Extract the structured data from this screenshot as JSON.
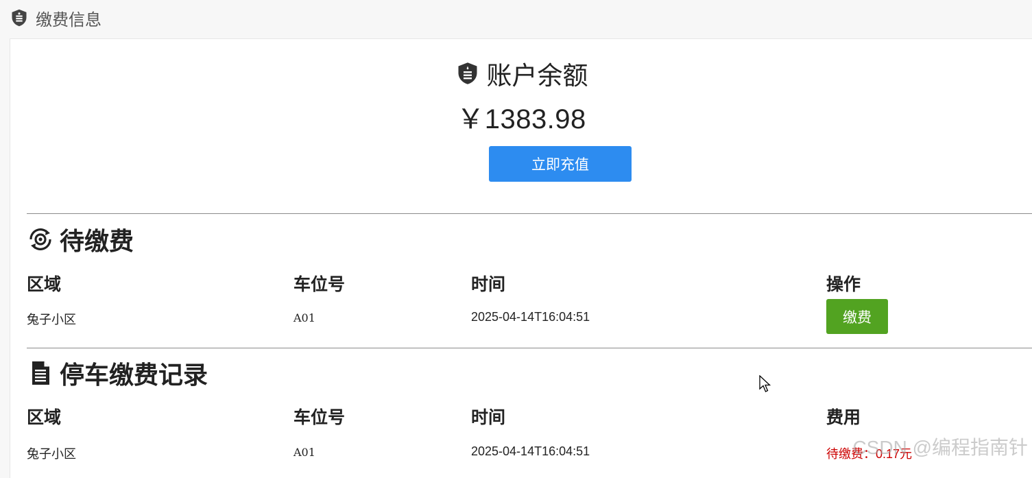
{
  "header": {
    "title": "缴费信息",
    "icon": "shield-icon"
  },
  "balance": {
    "title": "账户余额",
    "title_icon": "shield-icon",
    "amount": "￥1383.98",
    "recharge_label": "立即充值",
    "recharge_color": "#2d8cf0"
  },
  "pending": {
    "title": "待缴费",
    "icon": "refresh-eye-icon",
    "columns": [
      "区域",
      "车位号",
      "时间",
      "操作"
    ],
    "rows": [
      {
        "area": "兔子小区",
        "space": "A01",
        "time": "2025-04-14T16:04:51",
        "action_label": "缴费"
      }
    ],
    "action_color": "#52a321"
  },
  "records": {
    "title": "停车缴费记录",
    "icon": "document-icon",
    "columns": [
      "区域",
      "车位号",
      "时间",
      "费用"
    ],
    "rows": [
      {
        "area": "兔子小区",
        "space": "A01",
        "time": "2025-04-14T16:04:51",
        "fee": "待缴费：0.17元"
      }
    ],
    "fee_color": "#cc0000"
  },
  "watermark": "CSDN @编程指南针"
}
